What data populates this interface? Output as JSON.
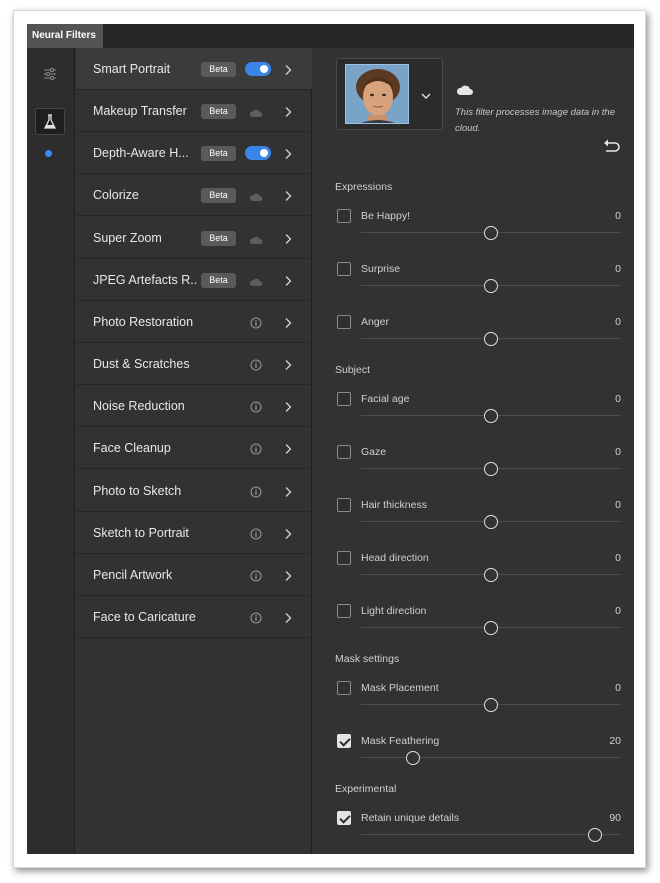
{
  "tab": {
    "label": "Neural Filters"
  },
  "filters": [
    {
      "label": "Smart Portrait",
      "badge": "Beta",
      "state": "toggle-on",
      "selected": true
    },
    {
      "label": "Makeup Transfer",
      "badge": "Beta",
      "state": "cloud"
    },
    {
      "label": "Depth-Aware H...",
      "badge": "Beta",
      "state": "toggle-on"
    },
    {
      "label": "Colorize",
      "badge": "Beta",
      "state": "cloud"
    },
    {
      "label": "Super Zoom",
      "badge": "Beta",
      "state": "cloud"
    },
    {
      "label": "JPEG Artefacts R...",
      "badge": "Beta",
      "state": "cloud"
    },
    {
      "label": "Photo Restoration",
      "state": "info"
    },
    {
      "label": "Dust & Scratches",
      "state": "info"
    },
    {
      "label": "Noise Reduction",
      "state": "info"
    },
    {
      "label": "Face Cleanup",
      "state": "info"
    },
    {
      "label": "Photo to Sketch",
      "state": "info"
    },
    {
      "label": "Sketch to Portrait",
      "state": "info"
    },
    {
      "label": "Pencil Artwork",
      "state": "info"
    },
    {
      "label": "Face to Caricature",
      "state": "info"
    }
  ],
  "panel": {
    "cloud_note": "This filter processes image data in the cloud.",
    "sections": [
      {
        "title": "Expressions",
        "rows": [
          {
            "label": "Be Happy!",
            "value": "0",
            "checked": false,
            "level": 0.5
          },
          {
            "label": "Surprise",
            "value": "0",
            "checked": false,
            "level": 0.5
          },
          {
            "label": "Anger",
            "value": "0",
            "checked": false,
            "level": 0.5
          }
        ]
      },
      {
        "title": "Subject",
        "rows": [
          {
            "label": "Facial age",
            "value": "0",
            "checked": false,
            "level": 0.5
          },
          {
            "label": "Gaze",
            "value": "0",
            "checked": false,
            "level": 0.5
          },
          {
            "label": "Hair thickness",
            "value": "0",
            "checked": false,
            "level": 0.5
          },
          {
            "label": "Head direction",
            "value": "0",
            "checked": false,
            "level": 0.5
          },
          {
            "label": "Light direction",
            "value": "0",
            "checked": false,
            "level": 0.5
          }
        ]
      },
      {
        "title": "Mask settings",
        "rows": [
          {
            "label": "Mask Placement",
            "value": "0",
            "checked": false,
            "level": 0.5
          },
          {
            "label": "Mask Feathering",
            "value": "20",
            "checked": true,
            "level": 0.2
          }
        ]
      },
      {
        "title": "Experimental",
        "rows": [
          {
            "label": "Retain unique details",
            "value": "90",
            "checked": true,
            "level": 0.9
          }
        ]
      }
    ]
  },
  "colors": {
    "accent": "#3a86e8",
    "background": "#323232",
    "badge": "#5a5a5a"
  }
}
